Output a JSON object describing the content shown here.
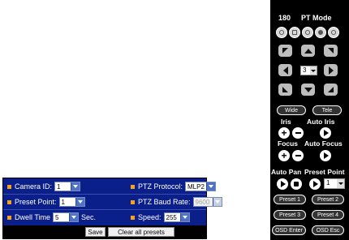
{
  "config": {
    "camera_id": {
      "label": "Camera ID:",
      "value": "1"
    },
    "ptz_protocol": {
      "label": "PTZ Protocol:",
      "value": "MLP2"
    },
    "preset_point": {
      "label": "Preset Point:",
      "value": "1"
    },
    "ptz_baud_rate": {
      "label": "PTZ Baud Rate:",
      "value": "9600"
    },
    "dwell_time": {
      "label": "Dwell Time",
      "value": "5",
      "unit": "Sec."
    },
    "speed": {
      "label": "Speed:",
      "value": "255"
    },
    "save_label": "Save",
    "clear_label": "Clear all presets"
  },
  "ptz": {
    "title_number": "180",
    "title_mode": "PT Mode",
    "speed_value": "3",
    "wide_label": "Wide",
    "tele_label": "Tele",
    "iris_label": "Iris",
    "auto_iris_label": "Auto Iris",
    "focus_label": "Focus",
    "auto_focus_label": "Auto Focus",
    "auto_pan_label": "Auto Pan",
    "preset_point_label": "Preset Point",
    "preset_value": "1",
    "preset_buttons": [
      "Preset 1",
      "Preset 2",
      "Preset 3",
      "Preset 4"
    ],
    "osd_enter_label": "OSD Enter",
    "osd_esc_label": "OSD Esc"
  },
  "colors": {
    "panel_blue": "#0b1f8a",
    "bullet_orange": "#f7a21b",
    "ptz_bg": "#000000"
  }
}
